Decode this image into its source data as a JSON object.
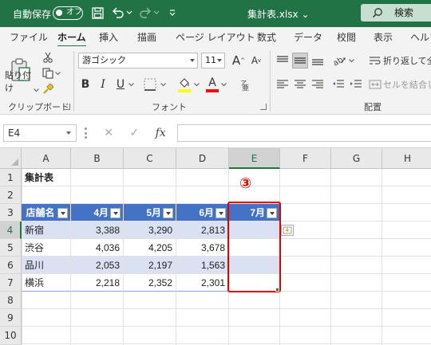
{
  "titlebar": {
    "autosave_label": "自動保存",
    "autosave_state": "オフ",
    "filename": "集計表.xlsx",
    "filename_chevron": "⌄",
    "search_label": "検索"
  },
  "tabs": [
    "ファイル",
    "ホーム",
    "挿入",
    "描画",
    "ページ レイアウト",
    "数式",
    "データ",
    "校閲",
    "表示",
    "ヘルプ"
  ],
  "ribbon": {
    "clipboard": {
      "paste_label": "貼り付け",
      "group_label": "クリップボード"
    },
    "font": {
      "font_name": "游ゴシック",
      "font_size": "11",
      "bold": "B",
      "italic": "I",
      "underline": "U",
      "font_color_glyph": "A",
      "highlight_glyph": "A",
      "group_label": "フォント"
    },
    "alignment": {
      "wrap_text": "折り返して全体",
      "merge_center": "セルを結合して",
      "group_label": "配置"
    }
  },
  "formula_bar": {
    "name_box": "E4",
    "cancel_glyph": "✕",
    "enter_glyph": "✓",
    "fx_glyph": "fx",
    "content": ""
  },
  "grid": {
    "columns": [
      "A",
      "B",
      "C",
      "D",
      "E",
      "F",
      "G",
      "H"
    ],
    "selected_column": "E",
    "rows": [
      "1",
      "2",
      "3",
      "4",
      "5",
      "6",
      "7",
      "8",
      "9",
      "10"
    ],
    "selected_row": "4",
    "cells": {
      "A1": "集計表",
      "A3": "店舗名",
      "B3": "4月",
      "C3": "5月",
      "D3": "6月",
      "E3": "7月",
      "A4": "新宿",
      "B4": "3,388",
      "C4": "3,290",
      "D4": "2,813",
      "A5": "渋谷",
      "B5": "4,036",
      "C5": "4,205",
      "D5": "3,678",
      "A6": "品川",
      "B6": "2,053",
      "C6": "2,197",
      "D6": "1,563",
      "A7": "横浜",
      "B7": "2,218",
      "C7": "2,352",
      "D7": "2,301"
    }
  },
  "annotation": {
    "step_number": "③",
    "color": "#e00000"
  },
  "colors": {
    "excel_green": "#217346",
    "table_header": "#4472c4",
    "table_band": "#d9e1f2"
  }
}
